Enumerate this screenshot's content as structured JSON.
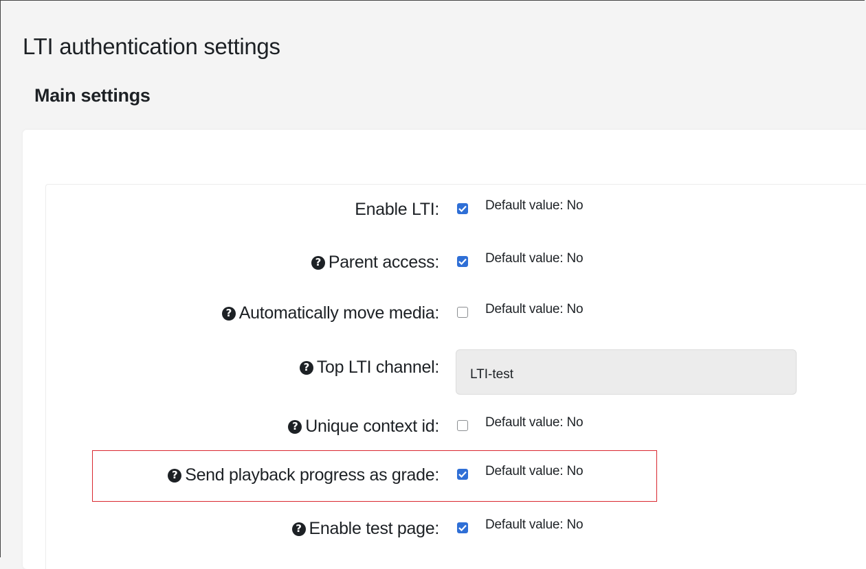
{
  "page": {
    "title": "LTI authentication settings",
    "section_title": "Main settings"
  },
  "settings": [
    {
      "label": "Enable LTI:",
      "has_help": false,
      "type": "checkbox",
      "checked": true,
      "default_text": "Default value: No"
    },
    {
      "label": "Parent access:",
      "has_help": true,
      "type": "checkbox",
      "checked": true,
      "default_text": "Default value: No"
    },
    {
      "label": "Automatically move media:",
      "has_help": true,
      "type": "checkbox",
      "checked": false,
      "default_text": "Default value: No"
    },
    {
      "label": "Top LTI channel:",
      "has_help": true,
      "type": "text",
      "value": "LTI-test"
    },
    {
      "label": "Unique context id:",
      "has_help": true,
      "type": "checkbox",
      "checked": false,
      "default_text": "Default value: No"
    },
    {
      "label": "Send playback progress as grade:",
      "has_help": true,
      "type": "checkbox",
      "checked": true,
      "default_text": "Default value: No",
      "highlighted": true
    },
    {
      "label": "Enable test page:",
      "has_help": true,
      "type": "checkbox",
      "checked": true,
      "default_text": "Default value: No"
    }
  ],
  "icons": {
    "help": "question-circle-icon",
    "check": "checkmark-icon"
  },
  "colors": {
    "checkbox_checked": "#2f6fd6",
    "highlight": "#d9262e",
    "help_icon": "#1d2125"
  }
}
